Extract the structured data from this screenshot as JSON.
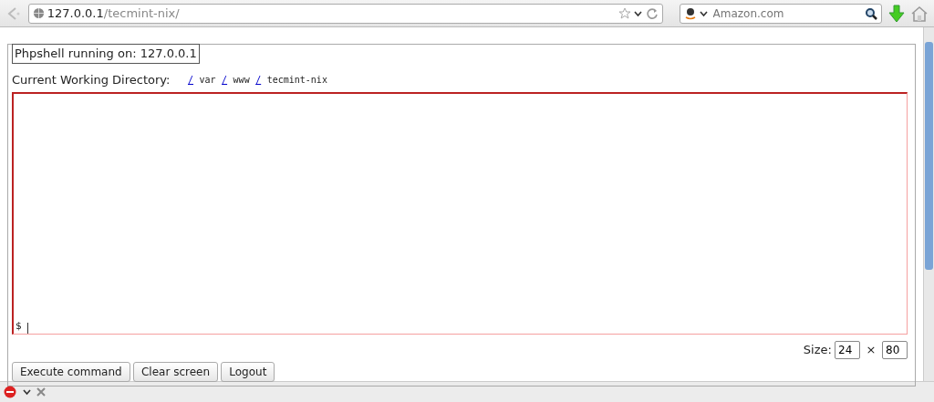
{
  "browser": {
    "url_host": "127.0.0.1",
    "url_path": "/tecmint-nix/",
    "search_placeholder": "Amazon.com"
  },
  "shell": {
    "legend": "Phpshell running on: 127.0.0.1",
    "cwd_label": "Current Working Directory:",
    "cwd_path": [
      {
        "kind": "link",
        "text": "/"
      },
      {
        "kind": "text",
        "text": "var"
      },
      {
        "kind": "link",
        "text": "/"
      },
      {
        "kind": "text",
        "text": "www"
      },
      {
        "kind": "link",
        "text": "/"
      },
      {
        "kind": "text",
        "text": "tecmint-nix"
      }
    ],
    "prompt": "$",
    "size_label": "Size:",
    "rows": "24",
    "times": "×",
    "cols": "80",
    "buttons": [
      "Execute command",
      "Clear screen",
      "Logout"
    ]
  }
}
